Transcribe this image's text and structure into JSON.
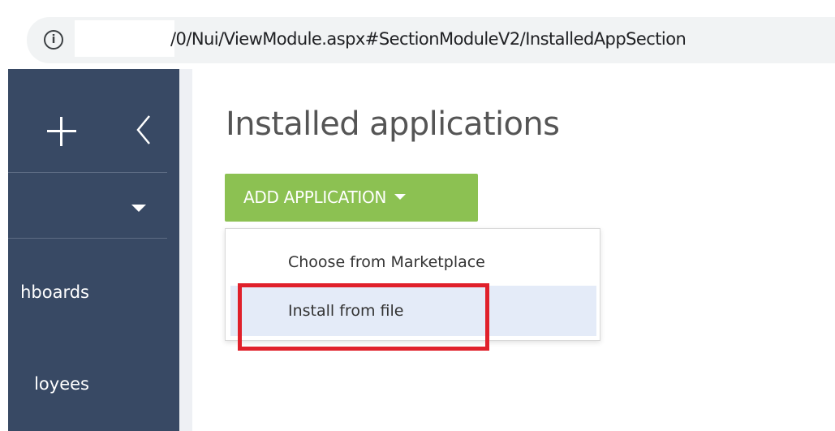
{
  "browser": {
    "url": "/0/Nui/ViewModule.aspx#SectionModuleV2/InstalledAppSection",
    "info_icon": "info-icon",
    "info_glyph": "i"
  },
  "sidebar": {
    "background": "#384964",
    "icons": [
      "plus-icon",
      "chevron-left-icon",
      "caret-down-icon"
    ],
    "items": [
      {
        "label": "Dashboards",
        "visible_text": "hboards"
      },
      {
        "label": "Employees",
        "visible_text": "loyees"
      }
    ]
  },
  "main": {
    "title": "Installed applications",
    "add_button": {
      "label": "ADD APPLICATION",
      "color": "#8cc152"
    },
    "dropdown": {
      "items": [
        {
          "label": "Choose from Marketplace",
          "active": false
        },
        {
          "label": "Install from file",
          "active": true
        }
      ]
    },
    "highlight": {
      "target": "Install from file",
      "color": "#e0202b"
    }
  }
}
